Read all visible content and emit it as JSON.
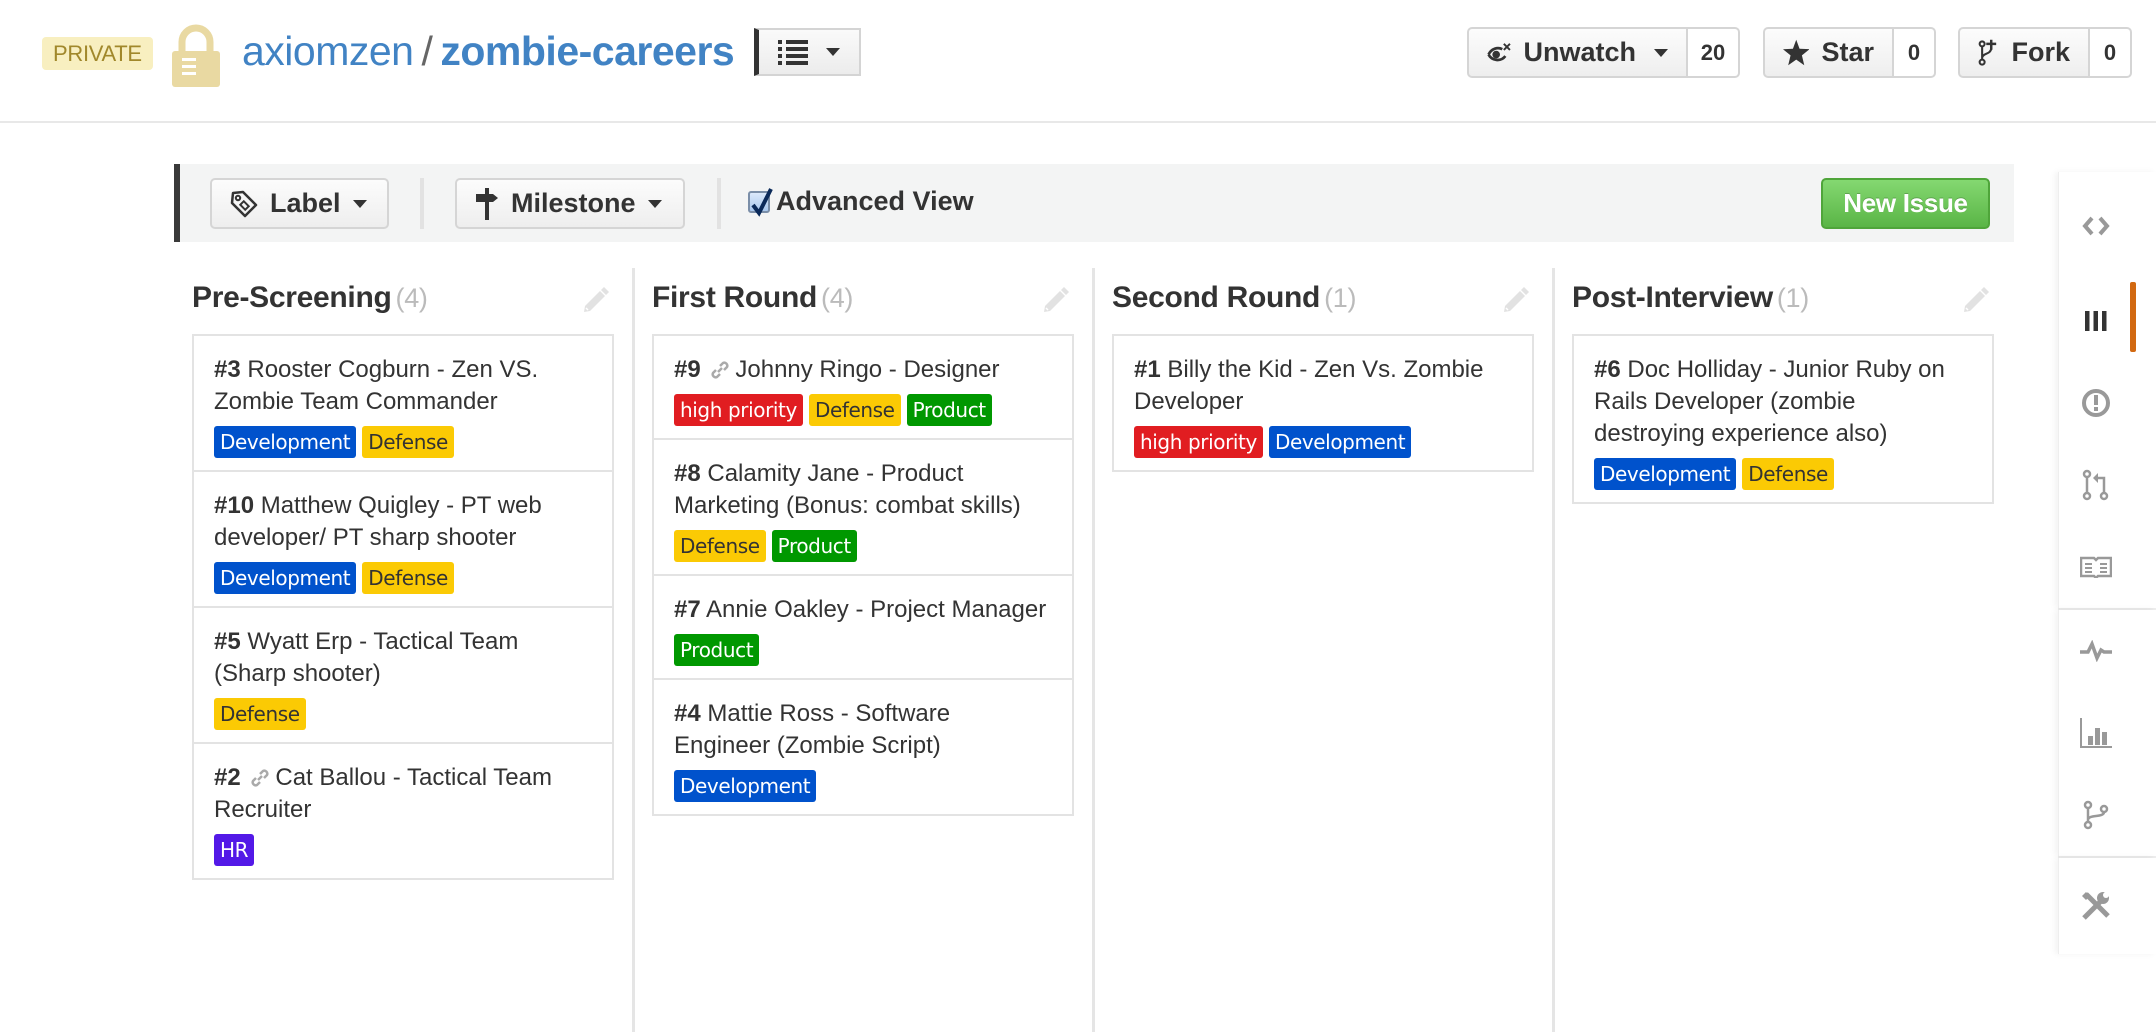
{
  "repo": {
    "visibility_badge": "PRIVATE",
    "owner": "axiomzen",
    "separator": "/",
    "name": "zombie-careers"
  },
  "actions": {
    "watch": {
      "label": "Unwatch",
      "count": "20"
    },
    "star": {
      "label": "Star",
      "count": "0"
    },
    "fork": {
      "label": "Fork",
      "count": "0"
    }
  },
  "toolbar": {
    "label_filter": "Label",
    "milestone_filter": "Milestone",
    "advanced_view_label": "Advanced View",
    "advanced_view_checked": true,
    "new_issue_label": "New Issue"
  },
  "label_colors": {
    "Development": {
      "bg": "#0052cc",
      "fg": "#ffffff"
    },
    "Defense": {
      "bg": "#fbca04",
      "fg": "#333333"
    },
    "Product": {
      "bg": "#009800",
      "fg": "#ffffff"
    },
    "high priority": {
      "bg": "#e11d21",
      "fg": "#ffffff"
    },
    "HR": {
      "bg": "#5319e7",
      "fg": "#ffffff"
    }
  },
  "columns": [
    {
      "title": "Pre-Screening",
      "count": "(4)",
      "cards": [
        {
          "number": "#3",
          "title": "Rooster Cogburn - Zen VS. Zombie Team Commander",
          "linked": false,
          "labels": [
            "Development",
            "Defense"
          ]
        },
        {
          "number": "#10",
          "title": "Matthew Quigley - PT web developer/ PT sharp shooter",
          "linked": false,
          "labels": [
            "Development",
            "Defense"
          ]
        },
        {
          "number": "#5",
          "title": "Wyatt Erp - Tactical Team (Sharp shooter)",
          "linked": false,
          "labels": [
            "Defense"
          ]
        },
        {
          "number": "#2",
          "title": "Cat Ballou - Tactical Team Recruiter",
          "linked": true,
          "labels": [
            "HR"
          ]
        }
      ]
    },
    {
      "title": "First Round",
      "count": "(4)",
      "cards": [
        {
          "number": "#9",
          "title": "Johnny Ringo - Designer",
          "linked": true,
          "labels": [
            "high priority",
            "Defense",
            "Product"
          ]
        },
        {
          "number": "#8",
          "title": "Calamity Jane - Product Marketing (Bonus: combat skills)",
          "linked": false,
          "labels": [
            "Defense",
            "Product"
          ]
        },
        {
          "number": "#7",
          "title": "Annie Oakley - Project Manager",
          "linked": false,
          "labels": [
            "Product"
          ]
        },
        {
          "number": "#4",
          "title": "Mattie Ross - Software Engineer (Zombie Script)",
          "linked": false,
          "labels": [
            "Development"
          ]
        }
      ]
    },
    {
      "title": "Second Round",
      "count": "(1)",
      "cards": [
        {
          "number": "#1",
          "title": "Billy the Kid - Zen Vs. Zombie Developer",
          "linked": false,
          "labels": [
            "high priority",
            "Development"
          ]
        }
      ]
    },
    {
      "title": "Post-Interview",
      "count": "(1)",
      "cards": [
        {
          "number": "#6",
          "title": "Doc Holliday - Junior Ruby on Rails Developer (zombie destroying experience also)",
          "linked": false,
          "labels": [
            "Development",
            "Defense"
          ]
        }
      ]
    }
  ],
  "sidebar": {
    "items": [
      {
        "icon": "code-icon",
        "active": false
      },
      {
        "icon": "board-icon",
        "active": true
      },
      {
        "icon": "issues-icon",
        "active": false
      },
      {
        "icon": "pull-request-icon",
        "active": false
      },
      {
        "icon": "wiki-icon",
        "active": false
      },
      {
        "icon": "pulse-icon",
        "active": false
      },
      {
        "icon": "graphs-icon",
        "active": false
      },
      {
        "icon": "network-icon",
        "active": false
      },
      {
        "icon": "settings-icon",
        "active": false
      }
    ],
    "accent_color": "#d26911"
  }
}
